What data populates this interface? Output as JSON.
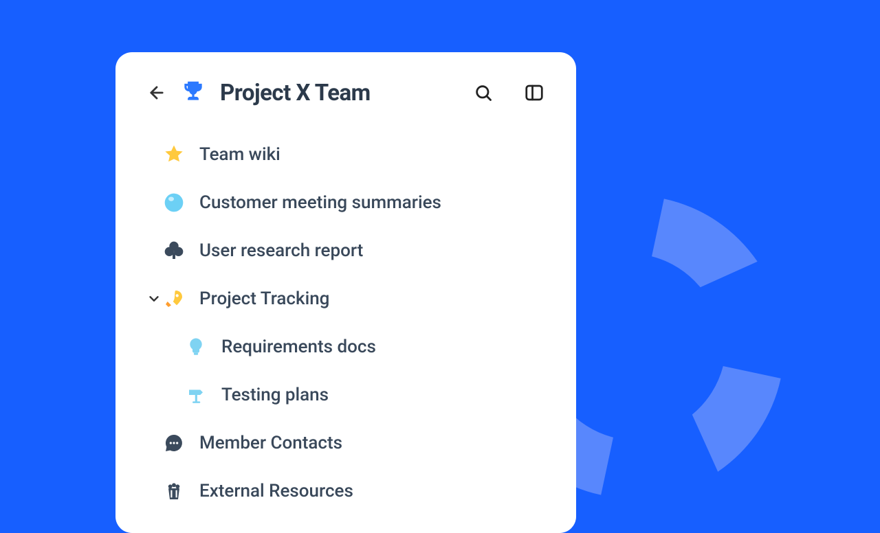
{
  "header": {
    "title": "Project X Team",
    "icon": "trophy-icon"
  },
  "nav": {
    "items": [
      {
        "icon": "star-icon",
        "label": "Team wiki"
      },
      {
        "icon": "bubble-icon",
        "label": "Customer meeting summaries"
      },
      {
        "icon": "club-icon",
        "label": "User research report"
      },
      {
        "icon": "rocket-icon",
        "label": "Project Tracking",
        "expanded": true,
        "children": [
          {
            "icon": "bulb-icon",
            "label": "Requirements docs"
          },
          {
            "icon": "signpost-icon",
            "label": "Testing plans"
          }
        ]
      },
      {
        "icon": "chat-icon",
        "label": "Member Contacts"
      },
      {
        "icon": "popcorn-icon",
        "label": "External Resources"
      }
    ]
  }
}
